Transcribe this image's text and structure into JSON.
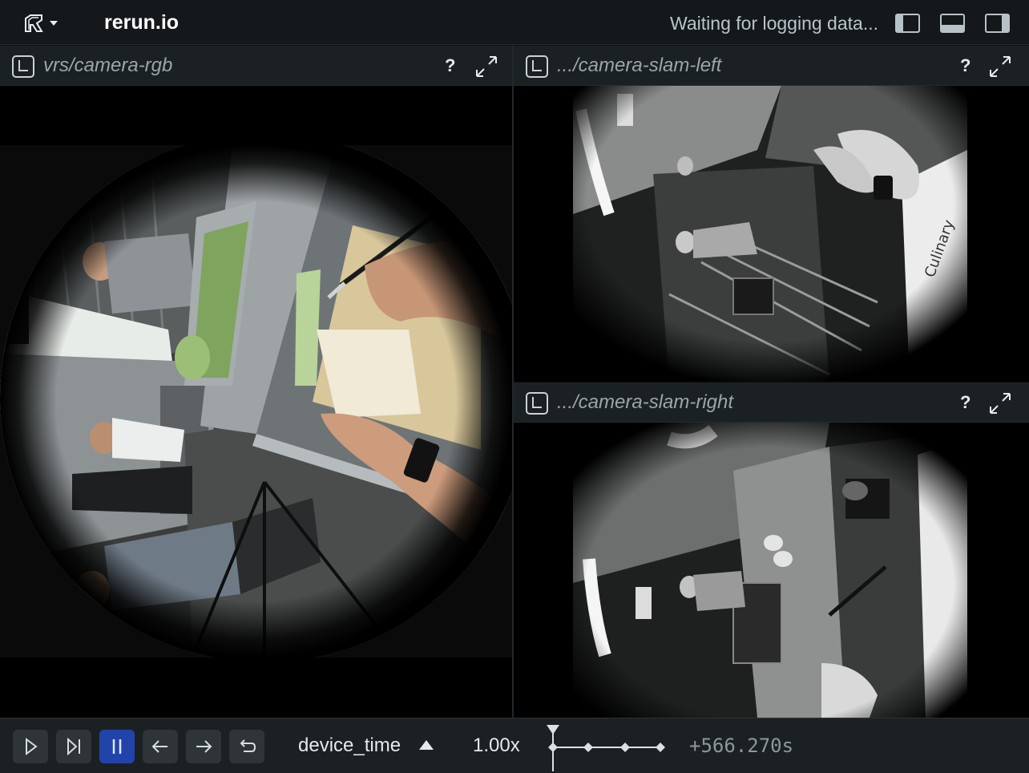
{
  "app": {
    "title": "rerun.io",
    "status": "Waiting for logging data..."
  },
  "views": {
    "rgb": {
      "title": "vrs/camera-rgb",
      "help": "?"
    },
    "slam_left": {
      "title": ".../camera-slam-left",
      "help": "?"
    },
    "slam_right": {
      "title": ".../camera-slam-right",
      "help": "?"
    }
  },
  "playback": {
    "timeline": "device_time",
    "speed": "1.00x",
    "time": "+566.270s"
  },
  "colors": {
    "accent": "#2244aa",
    "panel": "#1b2022",
    "background": "#0d0f10"
  },
  "icons": [
    "rerun-logo-icon",
    "chevron-down-icon",
    "left-panel-toggle-icon",
    "bottom-panel-toggle-icon",
    "right-panel-toggle-icon",
    "space-view-2d-icon",
    "help-icon",
    "maximize-icon",
    "play-icon",
    "step-forward-icon",
    "pause-icon",
    "step-back-icon",
    "step-next-icon",
    "loop-icon",
    "sort-asc-icon"
  ]
}
